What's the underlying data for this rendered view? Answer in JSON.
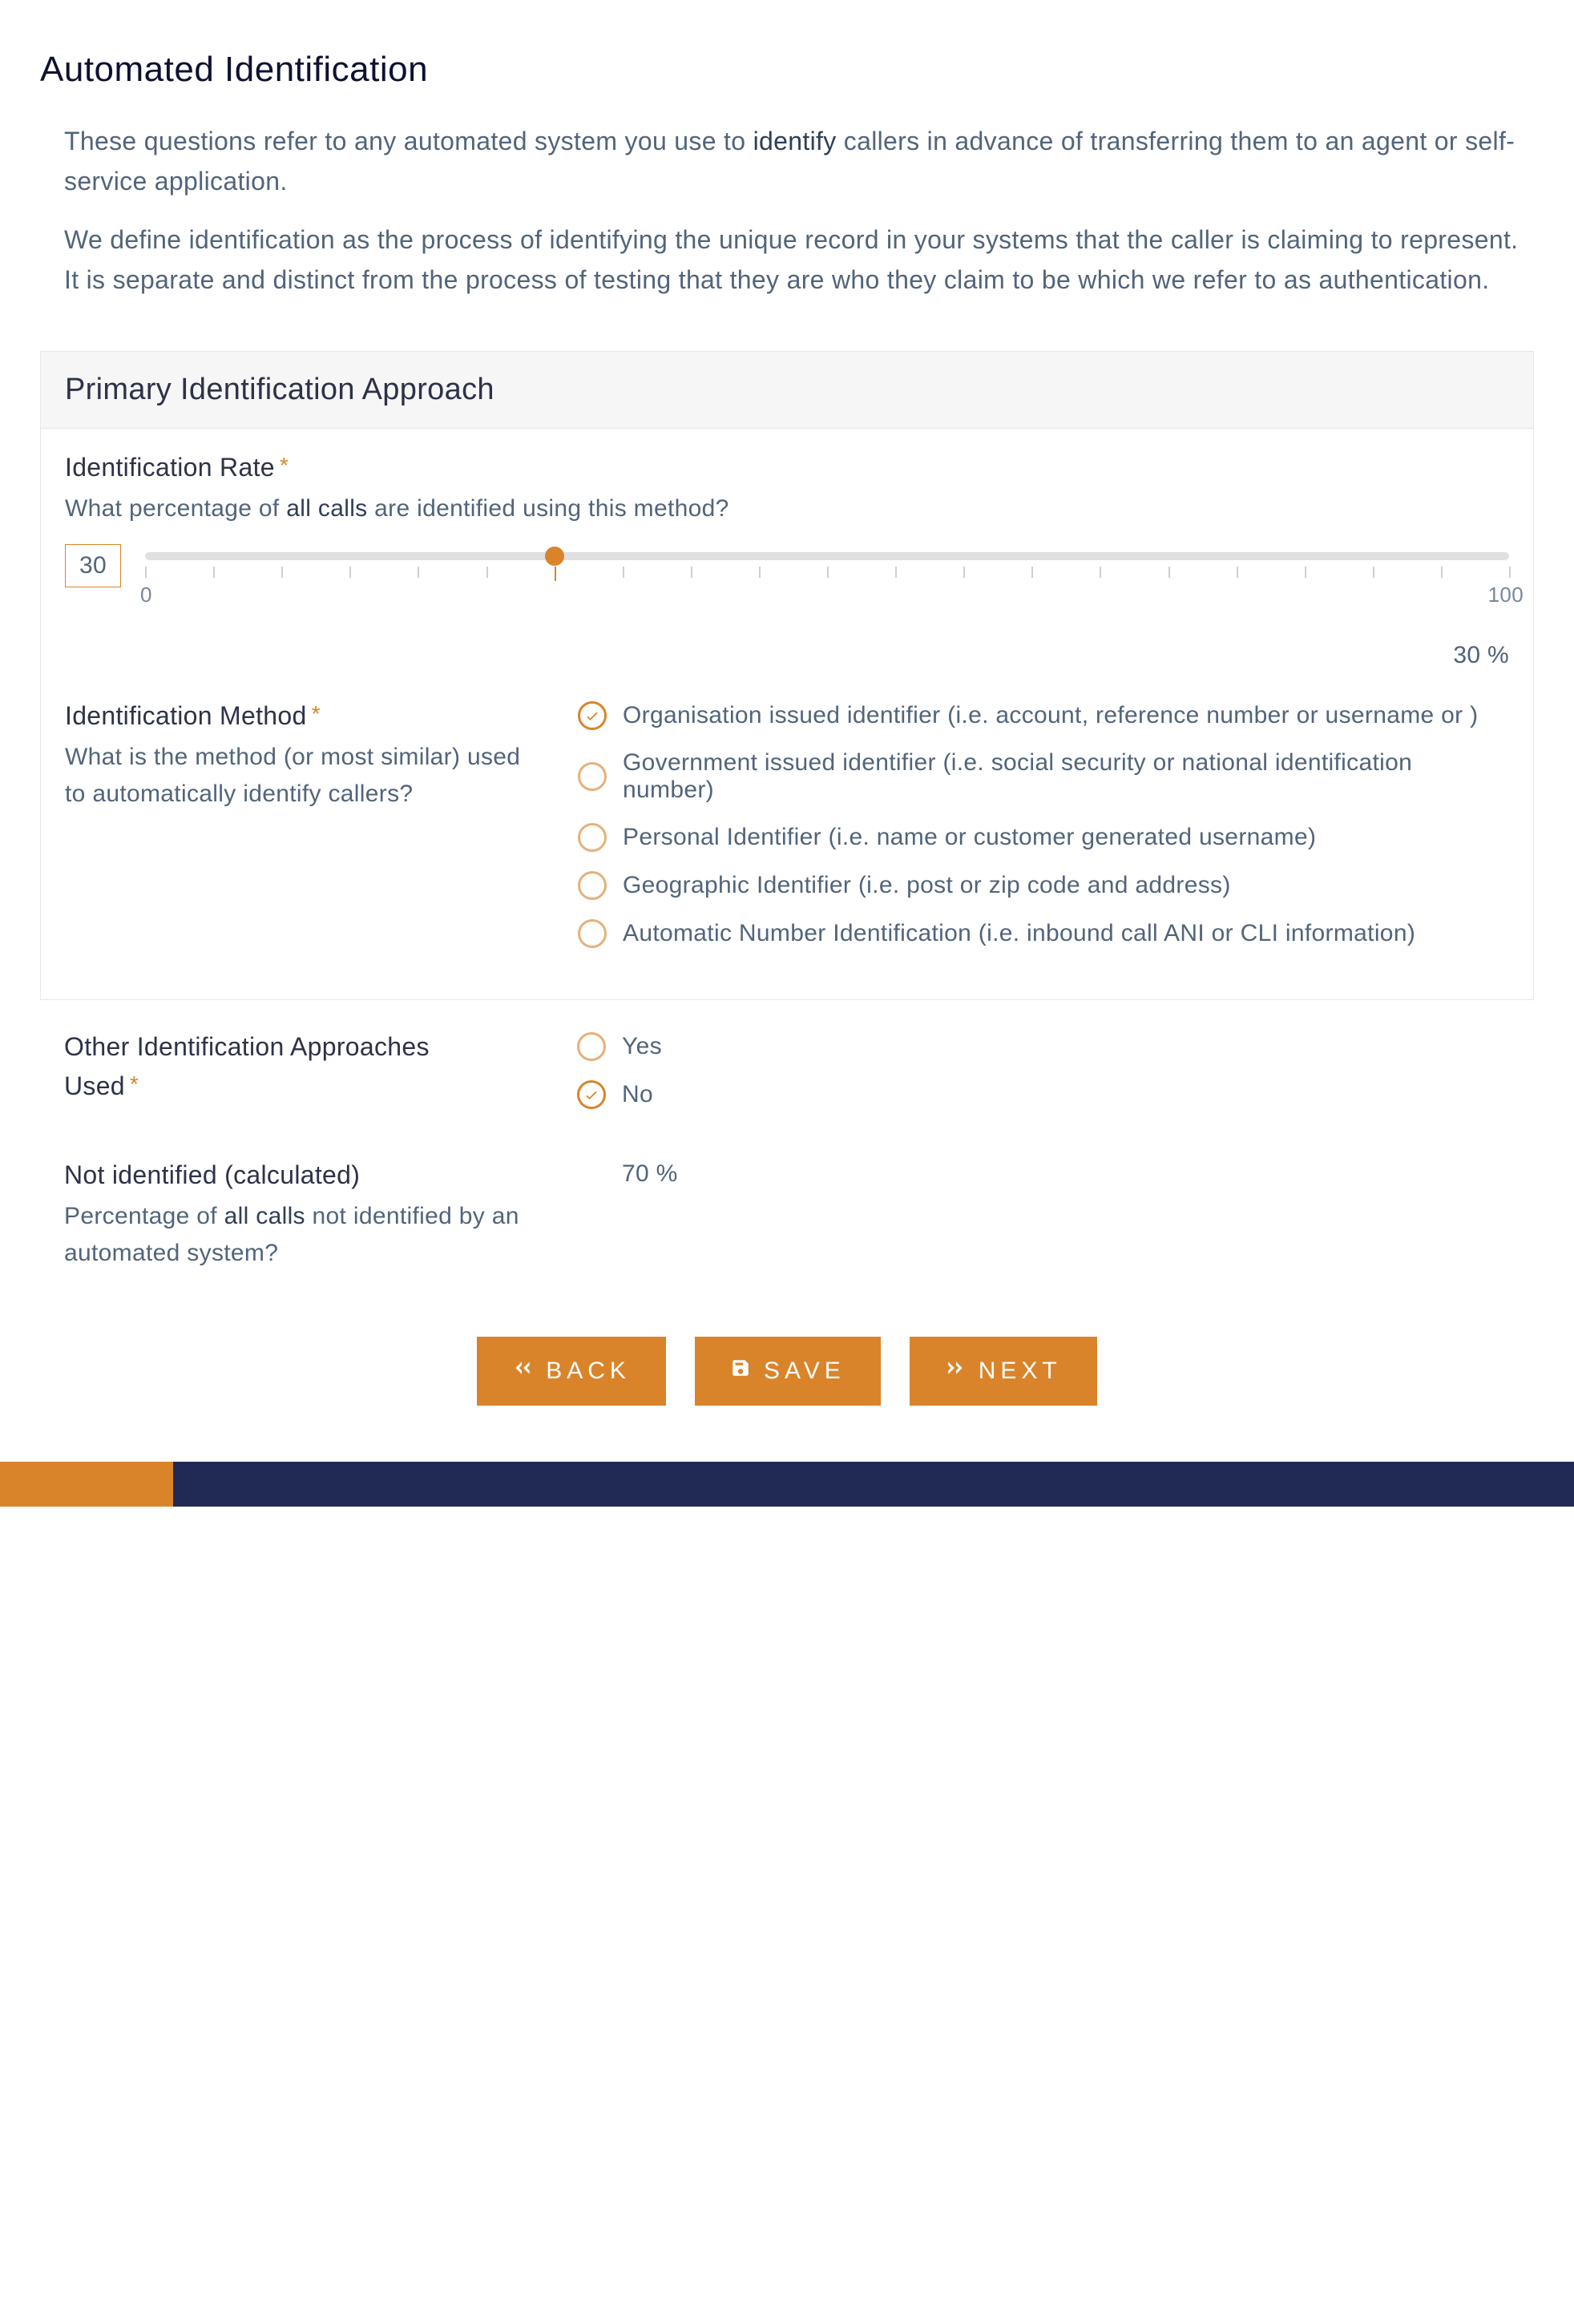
{
  "page": {
    "title": "Automated Identification",
    "intro_p1_a": "These questions refer to any automated system you use to ",
    "intro_p1_em": "identify",
    "intro_p1_b": " callers in advance of transferring them to an agent or self-service application.",
    "intro_p2": "We define identification as the process of identifying the unique record in your systems that the caller is claiming to represent. It is separate and distinct from the process of testing that they are who they claim to be which we refer to as authentication."
  },
  "panel": {
    "header": "Primary Identification Approach"
  },
  "rate": {
    "label": "Identification Rate",
    "required_mark": "*",
    "help_a": "What percentage of ",
    "help_em": "all calls",
    "help_b": " are identified using this method?",
    "value": "30",
    "min_label": "0",
    "max_label": "100",
    "readout": "30 %",
    "thumb_pct": 30
  },
  "method": {
    "label": "Identification Method",
    "required_mark": "*",
    "help": "What is the method (or most similar) used to automatically identify callers?",
    "selected_index": 0,
    "options": [
      "Organisation issued identifier (i.e. account, reference number or username or )",
      "Government issued identifier (i.e. social security or national identification number)",
      "Personal Identifier (i.e. name or customer generated username)",
      "Geographic Identifier (i.e. post or zip code and address)",
      "Automatic Number Identification (i.e. inbound call ANI or CLI information)"
    ]
  },
  "other": {
    "label_line1": "Other Identification Approaches",
    "label_line2": "Used",
    "required_mark": "*",
    "selected_index": 1,
    "options": [
      "Yes",
      "No"
    ]
  },
  "calc": {
    "label": "Not identified (calculated)",
    "help_a": "Percentage of ",
    "help_em": "all calls",
    "help_b": " not identified by an automated system?",
    "value": "70 %"
  },
  "buttons": {
    "back": "BACK",
    "save": "SAVE",
    "next": "NEXT"
  }
}
